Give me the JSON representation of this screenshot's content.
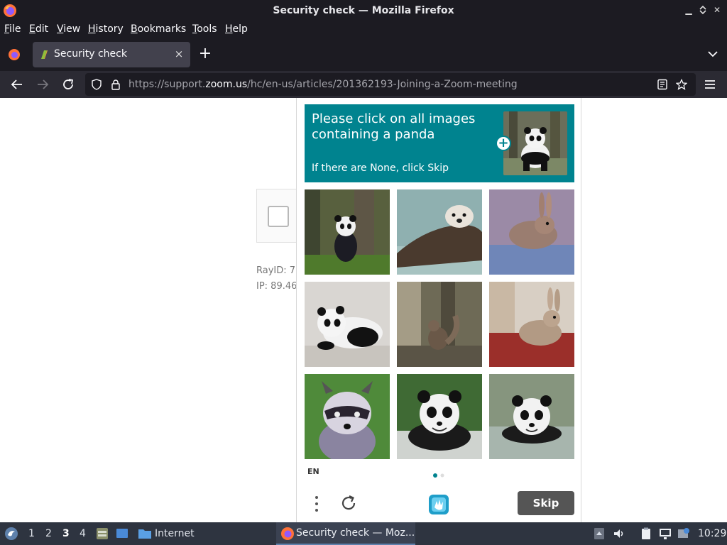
{
  "window": {
    "title": "Security check — Mozilla Firefox"
  },
  "menu": {
    "items": [
      "File",
      "Edit",
      "View",
      "History",
      "Bookmarks",
      "Tools",
      "Help"
    ],
    "first_letters": [
      "F",
      "E",
      "V",
      "H",
      "B",
      "T",
      "H"
    ],
    "rests": [
      "ile",
      "dit",
      "iew",
      "istory",
      "ookmarks",
      "ools",
      "elp"
    ]
  },
  "tab": {
    "title": "Security check",
    "close_glyph": "×",
    "new_tab_glyph": "+"
  },
  "nav": {
    "url_prefix": "https://support.",
    "url_host": "zoom.us",
    "url_path": "/hc/en-us/articles/201362193-Joining-a-Zoom-meeting"
  },
  "page": {
    "ray_id": "RayID: 7",
    "ip": "IP: 89.46"
  },
  "captcha": {
    "prompt": "Please click on all images containing a panda",
    "sub": "If there are None, click Skip",
    "sample_plus": "+",
    "tiles": [
      "panda",
      "otter",
      "rabbit",
      "panda",
      "squirrel",
      "rabbit",
      "raccoon",
      "panda",
      "panda"
    ],
    "lang": "EN",
    "skip_label": "Skip",
    "accent": "#00838f"
  },
  "taskbar": {
    "workspaces": [
      "1",
      "2",
      "3",
      "4"
    ],
    "active_workspace": "3",
    "launcher_label": "Internet",
    "task_label": "Security check — Moz...",
    "clock": "10:29"
  }
}
